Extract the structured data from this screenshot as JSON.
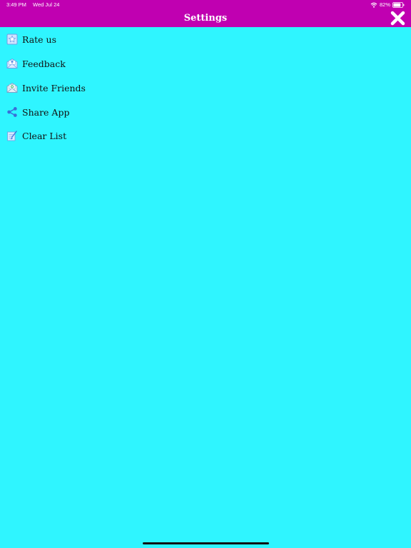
{
  "status_bar": {
    "time": "3:49 PM",
    "date": "Wed Jul 24",
    "battery": "82%",
    "battery_level": 0.82,
    "wifi_icon": "wifi-icon",
    "battery_icon": "battery-icon"
  },
  "header": {
    "title": "Settings",
    "close_icon": "close-icon",
    "background_color": "#c000b1",
    "title_color": "#ffffff"
  },
  "menu": {
    "items": [
      {
        "label": "Rate us",
        "icon": "star-icon"
      },
      {
        "label": "Feedback",
        "icon": "mail-icon"
      },
      {
        "label": "Invite Friends",
        "icon": "invite-mail-icon"
      },
      {
        "label": "Share App",
        "icon": "share-icon"
      },
      {
        "label": "Clear List",
        "icon": "clear-list-icon"
      }
    ]
  },
  "colors": {
    "background": "#2ff5ff",
    "icon_blue": "#3a6fd8",
    "icon_light": "#cfe3ff"
  }
}
